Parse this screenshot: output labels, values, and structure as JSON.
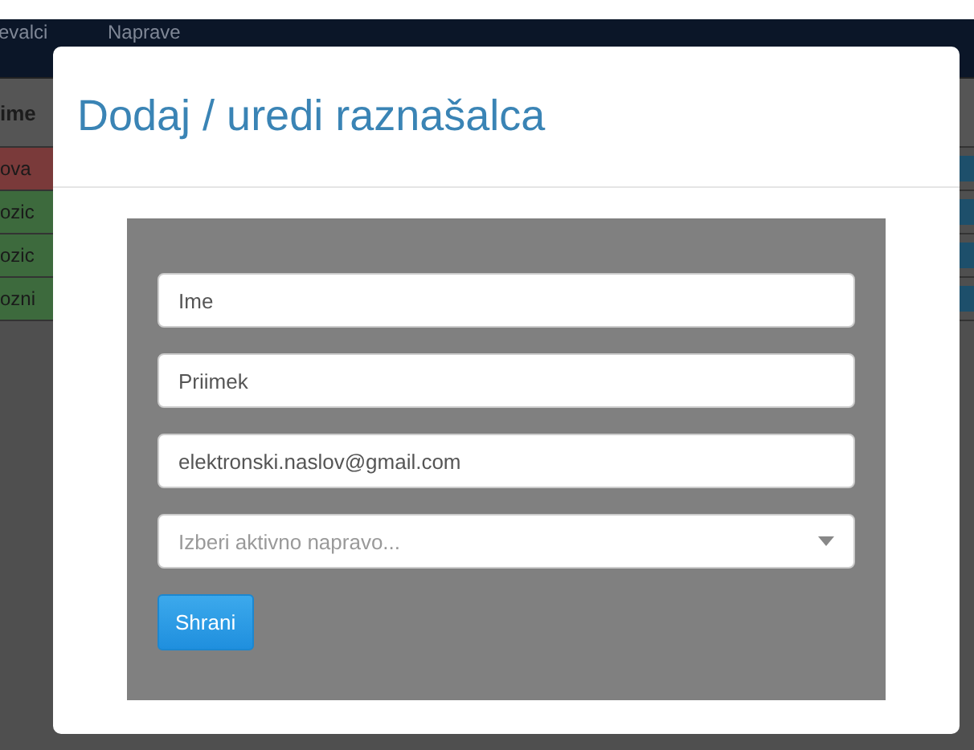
{
  "navbar": {
    "items": [
      {
        "label": "evalci"
      },
      {
        "label": "Naprave"
      }
    ]
  },
  "table": {
    "header": "ime",
    "rows": [
      {
        "cell": "ova",
        "color": "#7a3a3a"
      },
      {
        "cell": "ozic",
        "color": "#3d6a3d"
      },
      {
        "cell": "ozic",
        "color": "#3d6a3d"
      },
      {
        "cell": "ozni",
        "color": "#3d6a3d"
      }
    ]
  },
  "modal": {
    "title": "Dodaj / uredi raznašalca",
    "fields": [
      {
        "kind": "text",
        "value": "Ime"
      },
      {
        "kind": "text",
        "value": "Priimek"
      },
      {
        "kind": "text",
        "value": "elektronski.naslov@gmail.com"
      },
      {
        "kind": "select",
        "placeholder": "Izberi aktivno napravo..."
      }
    ],
    "button": "Shrani"
  }
}
